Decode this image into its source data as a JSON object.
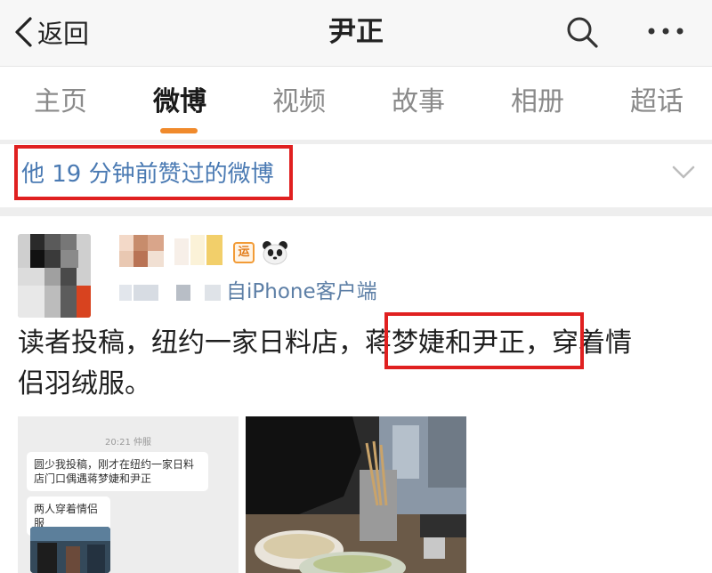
{
  "navbar": {
    "back_label": "返回",
    "title": "尹正"
  },
  "tabs": [
    {
      "label": "主页"
    },
    {
      "label": "微博"
    },
    {
      "label": "视频"
    },
    {
      "label": "故事"
    },
    {
      "label": "相册"
    },
    {
      "label": "超话"
    }
  ],
  "liked_row": {
    "text": "他 19 分钟前赞过的微博"
  },
  "post": {
    "badge_label": "运",
    "source": "自iPhone客户端",
    "text_line1": "读者投稿，纽约一家日料店，蒋梦婕和尹正，穿着情",
    "text_line2": "侣羽绒服。",
    "images": [
      {
        "date": "20:21 仲服",
        "bubble1": "圆少我投稿，刚才在纽约一家日料店门口偶遇蒋梦婕和尹正",
        "bubble2": "两人穿着情侣服"
      }
    ]
  },
  "colors": {
    "accent": "#f08a2c",
    "link": "#4a7ab3",
    "highlight_box": "#e02020"
  },
  "icons": [
    "chevron-left-icon",
    "search-icon",
    "more-icon",
    "chevron-down-icon",
    "panda-icon"
  ]
}
